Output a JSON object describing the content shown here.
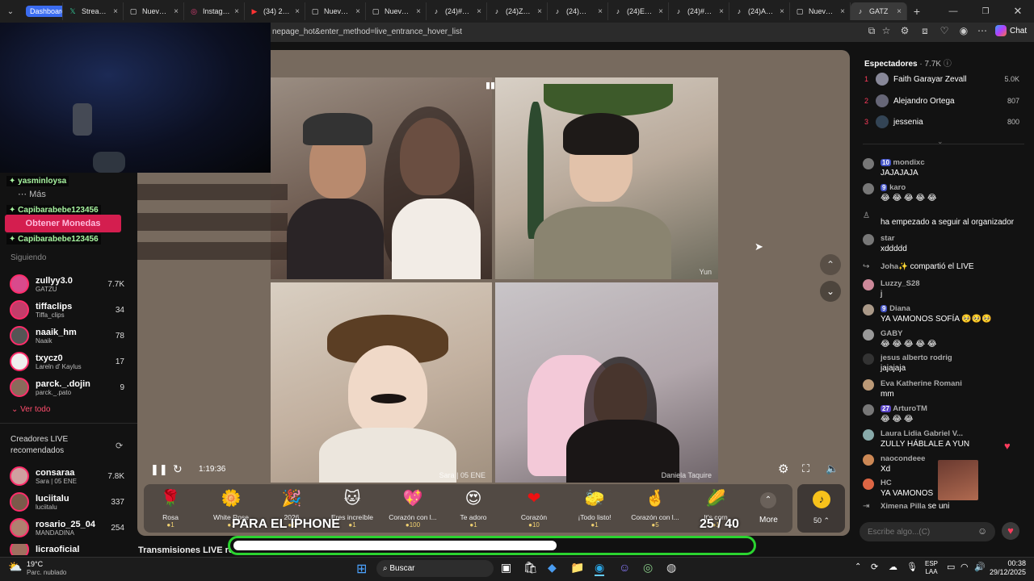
{
  "browser": {
    "tabs": [
      {
        "label": "Dashboard",
        "icon": "dashboard-pill"
      },
      {
        "label": "Stream - ",
        "icon": "X"
      },
      {
        "label": "Nueva pe",
        "icon": "▢"
      },
      {
        "label": "Instagram",
        "icon": "◎"
      },
      {
        "label": "(34) 2014",
        "icon": "▶"
      },
      {
        "label": "Nueva pe",
        "icon": "▢"
      },
      {
        "label": "Nueva pe",
        "icon": "▢"
      },
      {
        "label": "(24)#agus",
        "icon": "♪"
      },
      {
        "label": "(24)Zully",
        "icon": "♪"
      },
      {
        "label": "(24)✨¡Bi",
        "icon": "♪"
      },
      {
        "label": "(24)Esta c",
        "icon": "♪"
      },
      {
        "label": "(24)#cañ",
        "icon": "♪"
      },
      {
        "label": "(24)APAR",
        "icon": "♪"
      },
      {
        "label": "Nueva pe",
        "icon": "▢"
      },
      {
        "label": "GATZ",
        "icon": "♪"
      }
    ],
    "address": "nepage_hot&enter_method=live_entrance_hover_list",
    "chat_button": "Chat"
  },
  "stream": {
    "timer": "1:19:36",
    "tile2_label": "Yun",
    "tile3_label": "Sara | 05 ENE",
    "tile4_label": "Daniela Taquire"
  },
  "overlay": {
    "tag1": "yasminloysa",
    "mas": "Más",
    "tag2": "Capibarabebe123456",
    "monedas": "Obtener Monedas",
    "tag3": "Capibarabebe123456",
    "siguiendo": "Siguiendo",
    "iphone": "PARA EL IPHONE",
    "counter": "25 / 40"
  },
  "following": [
    {
      "name": "zullyy3.0",
      "sub": "GATZU",
      "count": "7.7K"
    },
    {
      "name": "tiffaclips",
      "sub": "Tiffa_clips",
      "count": "34"
    },
    {
      "name": "naaik_hm",
      "sub": "Naaik",
      "count": "78"
    },
    {
      "name": "txycz0",
      "sub": "Lareln d' Kaylus",
      "count": "17"
    },
    {
      "name": "parck._.dojin",
      "sub": "parck._.pato",
      "count": "9"
    }
  ],
  "ver_todo": "Ver todo",
  "creators_title": "Creadores LIVE recomendados",
  "creators": [
    {
      "name": "consaraa",
      "sub": "Sara | 05 ENE",
      "count": "7.8K"
    },
    {
      "name": "luciitalu",
      "sub": "luciitalu",
      "count": "337"
    },
    {
      "name": "rosario_25_04",
      "sub": "MANDADINA",
      "count": "254"
    },
    {
      "name": "licraoficial",
      "sub": "",
      "count": ""
    }
  ],
  "transmisiones": "Transmisiones LIVE recomendadas",
  "viewers": {
    "title": "Espectadores",
    "count": "7.7K",
    "list": [
      {
        "rank": "1",
        "name": "Faith Garayar Zevall",
        "score": "5.0K"
      },
      {
        "rank": "2",
        "name": "Alejandro Ortega",
        "score": "807"
      },
      {
        "rank": "3",
        "name": "jessenia",
        "score": "800"
      }
    ]
  },
  "chat": [
    {
      "user": "mondixc",
      "badge": "10",
      "msg": "JAJAJAJA"
    },
    {
      "user": "karo",
      "badge": "9",
      "msg": "😂 😂 😂 😂 😂"
    },
    {
      "user": "",
      "badge": "",
      "msg": "ha empezado a seguir al organizador"
    },
    {
      "user": "star",
      "badge": "",
      "msg": "xddddd"
    },
    {
      "user": "Joha✨",
      "badge": "",
      "msg": "compartió el LIVE"
    },
    {
      "user": "Luzzy_S28",
      "badge": "",
      "msg": "j"
    },
    {
      "user": "Diana",
      "badge": "9",
      "msg": "YA VAMONOS SOFÍA 🥺🥺🥺"
    },
    {
      "user": "GABY",
      "badge": "",
      "msg": "😂 😂 😂 😂 😂"
    },
    {
      "user": "jesus alberto rodrig",
      "badge": "",
      "msg": "jajajaja"
    },
    {
      "user": "Eva Katherine Romani",
      "badge": "",
      "msg": "mm"
    },
    {
      "user": "ArturoTM",
      "badge": "27",
      "msg": "😂 😂 😂"
    },
    {
      "user": "Laura Lidia Gabriel V...",
      "badge": "",
      "msg": "ZULLY HÁBLALE A YUN"
    },
    {
      "user": "naocondeee",
      "badge": "",
      "msg": "Xd"
    },
    {
      "user": "HC",
      "badge": "",
      "msg": "YA VAMONOS"
    },
    {
      "user": "Ximena Pilla",
      "badge": "",
      "msg": "se uni"
    }
  ],
  "chat_placeholder": "Escribe algo...(C)",
  "gifts": [
    {
      "icon": "🌹",
      "name": "Rosa",
      "price": "1"
    },
    {
      "icon": "🌼",
      "name": "White Rose",
      "price": "1"
    },
    {
      "icon": "🎉",
      "name": "2026",
      "price": "1"
    },
    {
      "icon": "🐱",
      "name": "Eres increíble",
      "price": "1"
    },
    {
      "icon": "💖",
      "name": "Corazón con l...",
      "price": "100"
    },
    {
      "icon": "😍",
      "name": "Te adoro",
      "price": "1"
    },
    {
      "icon": "❤",
      "name": "Corazón",
      "price": "10"
    },
    {
      "icon": "🧽",
      "name": "¡Todo listo!",
      "price": "1"
    },
    {
      "icon": "🤞",
      "name": "Corazón con l...",
      "price": "5"
    },
    {
      "icon": "🌽",
      "name": "It's corn",
      "price": "1"
    }
  ],
  "more_label": "More",
  "coins_label": "50",
  "taskbar": {
    "temp": "19°C",
    "weather": "Parc. nublado",
    "search": "Buscar",
    "lang": "ESP",
    "lang2": "LAA",
    "time": "00:38",
    "date": "29/12/2025"
  }
}
